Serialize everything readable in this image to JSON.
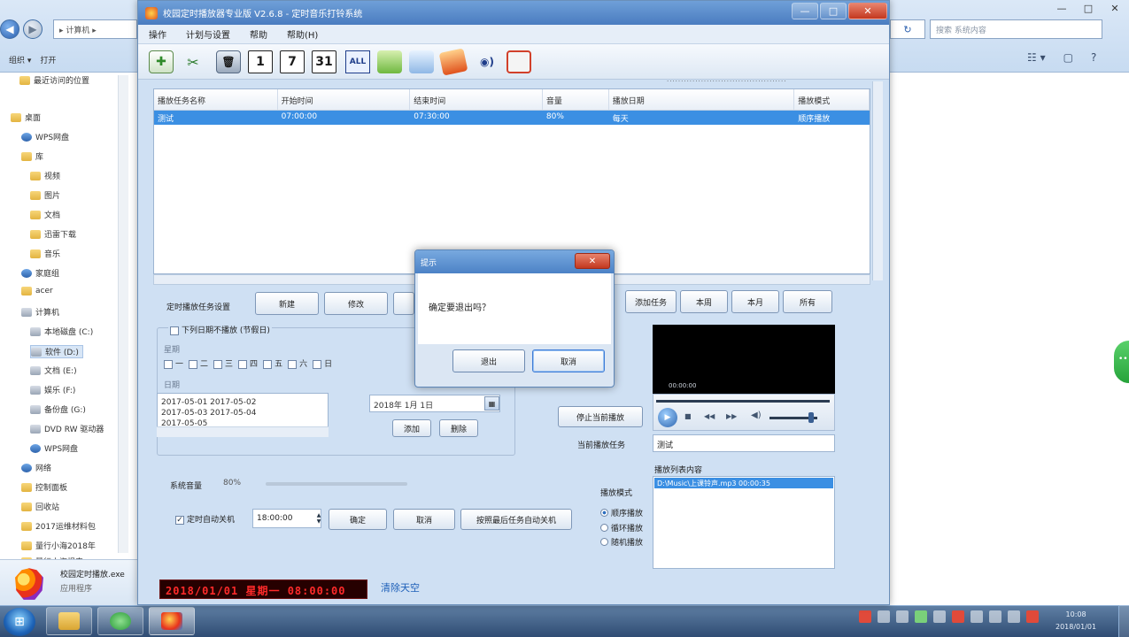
{
  "explorer": {
    "address_text": "▸ 计算机 ▸",
    "search_placeholder": "搜索 系统内容",
    "toolbar": [
      "组织 ▾",
      "打开"
    ],
    "sidebar": [
      {
        "label": "最近访问的位置",
        "icon": "folder"
      },
      {
        "label": "桌面",
        "icon": "folder"
      },
      {
        "label": "WPS网盘",
        "icon": "net"
      },
      {
        "label": "库",
        "icon": "folder"
      },
      {
        "label": "视频",
        "icon": "folder"
      },
      {
        "label": "图片",
        "icon": "folder"
      },
      {
        "label": "文档",
        "icon": "folder"
      },
      {
        "label": "迅雷下载",
        "icon": "folder"
      },
      {
        "label": "音乐",
        "icon": "folder"
      },
      {
        "label": "家庭组",
        "icon": "net"
      },
      {
        "label": "acer",
        "icon": "folder"
      },
      {
        "label": "计算机",
        "icon": "drive"
      },
      {
        "label": "本地磁盘 (C:)",
        "icon": "drive"
      },
      {
        "label": "软件 (D:)",
        "icon": "drive"
      },
      {
        "label": "文档 (E:)",
        "icon": "drive"
      },
      {
        "label": "娱乐 (F:)",
        "icon": "drive"
      },
      {
        "label": "备份盘 (G:)",
        "icon": "drive"
      },
      {
        "label": "DVD RW 驱动器",
        "icon": "drive"
      },
      {
        "label": "WPS网盘",
        "icon": "net"
      },
      {
        "label": "网络",
        "icon": "net"
      },
      {
        "label": "控制面板",
        "icon": "folder"
      },
      {
        "label": "回收站",
        "icon": "folder"
      },
      {
        "label": "2017运维材料包",
        "icon": "folder"
      },
      {
        "label": "量行小海2018年",
        "icon": "folder"
      },
      {
        "label": "量行小海报表 ▸",
        "icon": "folder"
      }
    ],
    "details": {
      "name": "校园定时播放.exe",
      "type": "应用程序"
    }
  },
  "app": {
    "title": "校园定时播放器专业版 V2.6.8 - 定时音乐打铃系统",
    "menu": [
      "操作",
      "计划与设置",
      "帮助",
      "帮助(H)"
    ],
    "toolbar_nums": [
      "1",
      "7",
      "31",
      "ALL"
    ],
    "list": {
      "columns": [
        "播放任务名称",
        "开始时间",
        "结束时间",
        "音量",
        "播放日期",
        "播放模式"
      ],
      "rows": [
        [
          "测试",
          "07:00:00",
          "07:30:00",
          "80%",
          "每天",
          "顺序播放"
        ]
      ],
      "caption": "··········································"
    },
    "form": {
      "task_label": "定时播放任务设置",
      "new_btn": "新建",
      "edit_btn": "修改",
      "right_btns": [
        "添加任务",
        "本周",
        "本月",
        "所有"
      ],
      "chk_label": "下列日期不播放 (节假日)",
      "week_caption": "星期",
      "weekdays": [
        "一",
        "二",
        "三",
        "四",
        "五",
        "六",
        "日"
      ],
      "date_caption": "日期",
      "dates": [
        "2017-05-01      2017-05-02",
        "2017-05-03      2017-05-04",
        "2017-05-05"
      ],
      "time_value": "2018年 1月 1日",
      "add_btn": "添加",
      "del_btn": "删除",
      "stop_btn": "停止当前播放",
      "now_label": "当前播放任务",
      "now_value": "测试",
      "playlist_label": "播放列表内容",
      "playlist_item": "D:\\Music\\上课铃声.mp3      00:00:35",
      "mode_label": "播放模式",
      "modes": [
        "顺序播放",
        "循环播放",
        "随机播放"
      ],
      "volume_label": "系统音量",
      "volume_value": "80%",
      "shutdown_label": "定时自动关机",
      "shutdown_time": "18:00:00",
      "confirm_btn": "确定",
      "cancel_btn": "取消",
      "bind_btn": "按照最后任务自动关机"
    },
    "player": {
      "time": "00:00:00"
    },
    "led": "2018/01/01 星期一 08:00:00",
    "led_link": "清除天空"
  },
  "dialog": {
    "title": "提示",
    "message": "确定要退出吗？",
    "ok": "退出",
    "cancel": "取消"
  },
  "taskbar": {
    "clock_time": "10:08",
    "clock_date": "2018/01/01"
  }
}
